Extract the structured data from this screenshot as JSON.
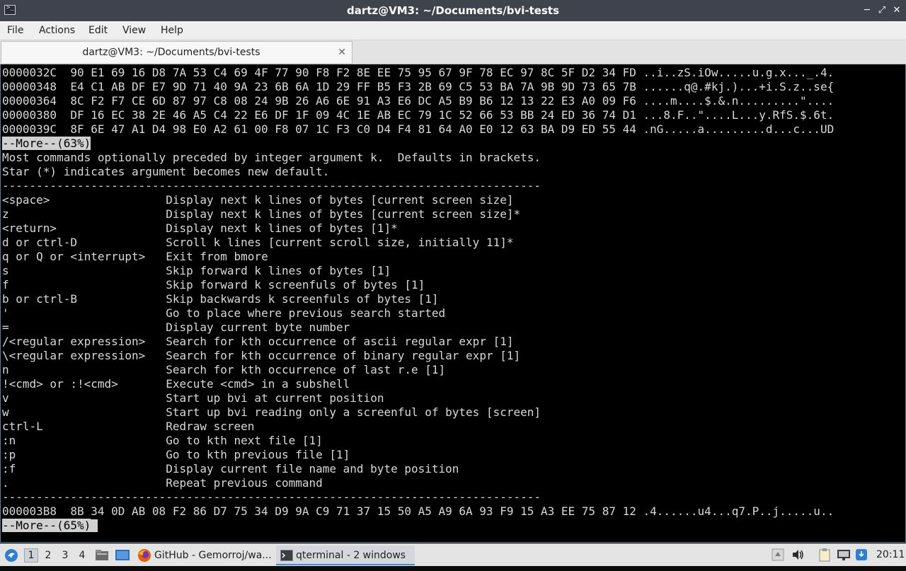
{
  "window": {
    "title": "dartz@VM3: ~/Documents/bvi-tests",
    "minimize_glyph": "─",
    "maximize_glyph": "⤢",
    "close_glyph": "✕",
    "app_icon_glyph": ">_"
  },
  "menu": {
    "file": "File",
    "actions": "Actions",
    "edit": "Edit",
    "view": "View",
    "help": "Help"
  },
  "tab": {
    "label": "dartz@VM3: ~/Documents/bvi-tests",
    "close_glyph": "✕"
  },
  "terminal": {
    "hex_rows": [
      "0000032C  90 E1 69 16 D8 7A 53 C4 69 4F 77 90 F8 F2 8E EE 75 95 67 9F 78 EC 97 8C 5F D2 34 FD ..i..zS.iOw.....u.g.x..._.4.",
      "00000348  E4 C1 AB DF E7 9D 71 40 9A 23 6B 6A 1D 29 FF B5 F3 2B 69 C5 53 BA 7A 9B 9D 73 65 7B ......q@.#kj.)...+i.S.z..se{",
      "00000364  8C F2 F7 CE 6D 87 97 C8 08 24 9B 26 A6 6E 91 A3 E6 DC A5 B9 B6 12 13 22 E3 A0 09 F6 ....m....$.&.n.........\"....",
      "00000380  DF 16 EC 38 2E 46 A5 C4 22 E6 DF 1F 09 4C 1E AB EC 79 1C 52 66 53 BB 24 ED 36 74 D1 ...8.F..\"....L...y.RfS.$.6t.",
      "0000039C  8F 6E 47 A1 D4 98 E0 A2 61 00 F8 07 1C F3 C0 D4 F4 81 64 A0 E0 12 63 BA D9 ED 55 44 .nG.....a.........d...c...UD"
    ],
    "more_prompt_1": "--More--(63%)",
    "help_intro_1": "Most commands optionally preceded by integer argument k.  Defaults in brackets.",
    "help_intro_2": "Star (*) indicates argument becomes new default.",
    "separator": "-------------------------------------------------------------------------------",
    "commands": [
      {
        "key": "<space>",
        "desc": "Display next k lines of bytes [current screen size]"
      },
      {
        "key": "z",
        "desc": "Display next k lines of bytes [current screen size]*"
      },
      {
        "key": "<return>",
        "desc": "Display next k lines of bytes [1]*"
      },
      {
        "key": "d or ctrl-D",
        "desc": "Scroll k lines [current scroll size, initially 11]*"
      },
      {
        "key": "q or Q or <interrupt>",
        "desc": "Exit from bmore"
      },
      {
        "key": "s",
        "desc": "Skip forward k lines of bytes [1]"
      },
      {
        "key": "f",
        "desc": "Skip forward k screenfuls of bytes [1]"
      },
      {
        "key": "b or ctrl-B",
        "desc": "Skip backwards k screenfuls of bytes [1]"
      },
      {
        "key": "'",
        "desc": "Go to place where previous search started"
      },
      {
        "key": "=",
        "desc": "Display current byte number"
      },
      {
        "key": "/<regular expression>",
        "desc": "Search for kth occurrence of ascii regular expr [1]"
      },
      {
        "key": "\\<regular expression>",
        "desc": "Search for kth occurrence of binary regular expr [1]"
      },
      {
        "key": "n",
        "desc": "Search for kth occurrence of last r.e [1]"
      },
      {
        "key": "!<cmd> or :!<cmd>",
        "desc": "Execute <cmd> in a subshell"
      },
      {
        "key": "v",
        "desc": "Start up bvi at current position"
      },
      {
        "key": "w",
        "desc": "Start up bvi reading only a screenful of bytes [screen]"
      },
      {
        "key": "ctrl-L",
        "desc": "Redraw screen"
      },
      {
        "key": ":n",
        "desc": "Go to kth next file [1]"
      },
      {
        "key": ":p",
        "desc": "Go to kth previous file [1]"
      },
      {
        "key": ":f",
        "desc": "Display current file name and byte position"
      },
      {
        "key": ".",
        "desc": "Repeat previous command"
      }
    ],
    "hex_row_after": "000003B8  8B 34 0D AB 08 F2 86 D7 75 34 D9 9A C9 71 37 15 50 A5 A9 6A 93 F9 15 A3 EE 75 87 12 .4......u4...q7.P..j.....u..",
    "more_prompt_2": "--More--(65%)"
  },
  "taskbar": {
    "workspaces": [
      "1",
      "2",
      "3",
      "4"
    ],
    "active_workspace": "1",
    "tasks": [
      {
        "label": "GitHub - Gemorroj/wa...",
        "icon": "firefox-icon"
      },
      {
        "label": "qterminal - 2 windows",
        "icon": "terminal-icon"
      }
    ],
    "clock": "20:11"
  },
  "colors": {
    "titlebar_bg": "#3e434c",
    "terminal_bg": "#000000",
    "terminal_fg": "#d8d8d8",
    "accent": "#3d8ee0"
  }
}
